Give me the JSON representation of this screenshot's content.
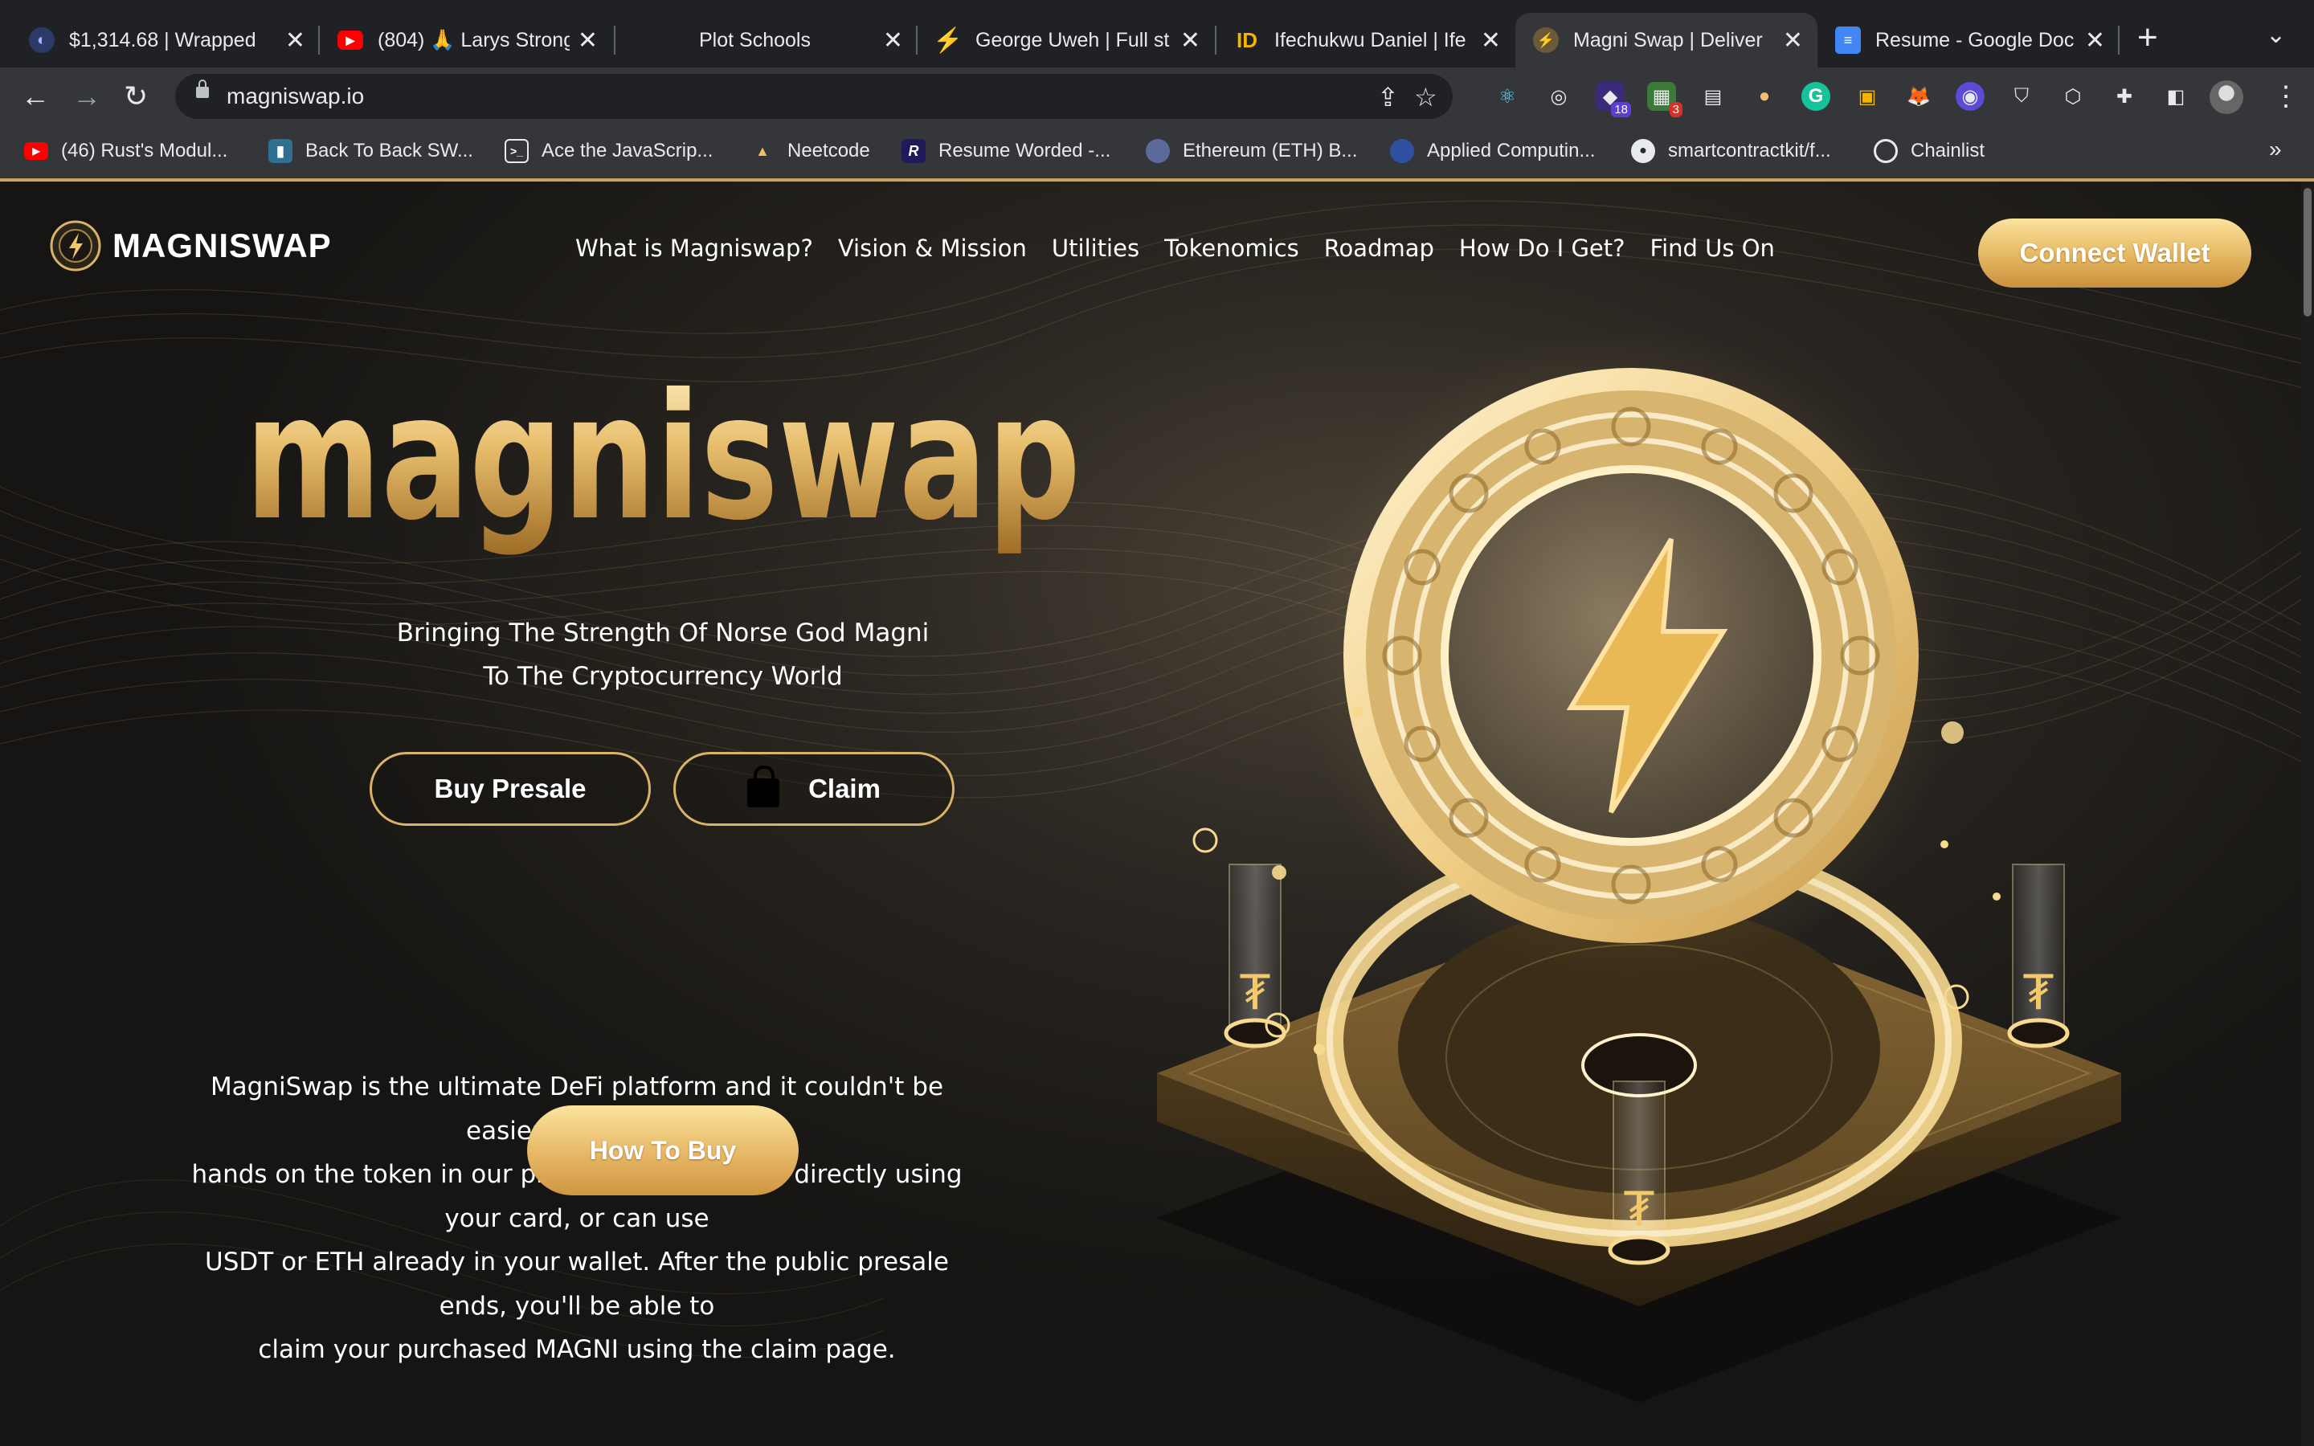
{
  "browser": {
    "tabs": [
      {
        "title": "$1,314.68 | Wrapped",
        "active": false
      },
      {
        "title": "(804) 🙏 Larys Strong",
        "active": false
      },
      {
        "title": "Plot Schools",
        "active": false
      },
      {
        "title": "George Uweh | Full st",
        "active": false
      },
      {
        "title": "Ifechukwu Daniel | Ife",
        "active": false
      },
      {
        "title": "Magni Swap | Deliver",
        "active": true
      },
      {
        "title": "Resume - Google Doc",
        "active": false
      }
    ],
    "url": "magniswap.io",
    "extension_badges": {
      "ext1": "18",
      "ext2": "3"
    },
    "bookmarks": [
      {
        "label": "(46) Rust's Modul...",
        "icon": "youtube-icon"
      },
      {
        "label": "Back To Back SW...",
        "icon": "bookmark-icon"
      },
      {
        "label": "Ace the JavaScrip...",
        "icon": "terminal-icon"
      },
      {
        "label": "Neetcode",
        "icon": "rocket-icon"
      },
      {
        "label": "Resume Worded -...",
        "icon": "r-icon"
      },
      {
        "label": "Ethereum (ETH) B...",
        "icon": "moon-icon"
      },
      {
        "label": "Applied Computin...",
        "icon": "globe-icon"
      },
      {
        "label": "smartcontractkit/f...",
        "icon": "github-icon"
      },
      {
        "label": "Chainlist",
        "icon": "globe-icon"
      }
    ],
    "more_bookmarks": "»"
  },
  "site": {
    "logo_text": "MAGNISWAP",
    "nav": [
      "What is Magniswap?",
      "Vision & Mission",
      "Utilities",
      "Tokenomics",
      "Roadmap",
      "How Do I Get?",
      "Find Us On"
    ],
    "connect_wallet": "Connect Wallet",
    "hero_wordmark": "magniswap",
    "tagline_line1": "Bringing The Strength Of Norse God Magni",
    "tagline_line2": "To The Cryptocurrency World",
    "buy_presale": "Buy Presale",
    "claim": "Claim",
    "description_lines": [
      "MagniSwap is the ultimate DeFi platform and it couldn't be easier to get your",
      "hands on the token in our pre-sale. You can buy directly using your card, or can use",
      "USDT or ETH already in your wallet. After the public presale ends, you'll be able to",
      "claim your purchased MAGNI using the claim page."
    ],
    "how_to_buy": "How To Buy"
  },
  "colors": {
    "gold_light": "#fbe39e",
    "gold": "#e2b25c",
    "gold_dark": "#c98f3c",
    "background": "#161513"
  }
}
